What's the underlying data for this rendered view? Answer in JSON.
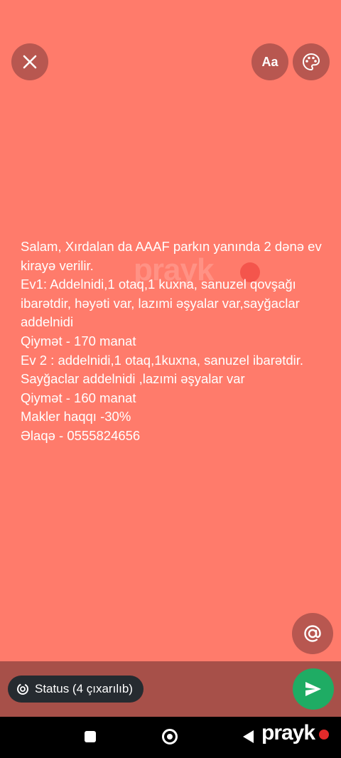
{
  "toolbar": {
    "font_label": "Aa"
  },
  "status_text": "Salam, Xırdalan da AAAF parkın yanında  2 dənə ev kirayə  verilir.\nEv1: Addelnidi,1 otaq,1 kuxna, sanuzel qovşağı ibarətdir, həyəti var, lazımi əşyalar var,sayğaclar addelnidi\nQiymət - 170 manat\nEv 2 : addelnidi,1 otaq,1kuxna, sanuzel ibarətdir. Sayğaclar addelnidi ,lazımi əşyalar var\nQiymət - 160 manat\nMakler haqqı -30%\nƏlaqə - 0555824656",
  "watermark": "prayk",
  "audience": {
    "label": "Status (4 çıxarılıb)"
  },
  "brand": "prayk",
  "colors": {
    "background": "#ff7b6b",
    "send": "#1fac64",
    "brand_dot": "#e22a2a"
  },
  "icons": [
    "close-icon",
    "palette-icon",
    "at-icon",
    "send-icon",
    "status-ring-icon"
  ]
}
